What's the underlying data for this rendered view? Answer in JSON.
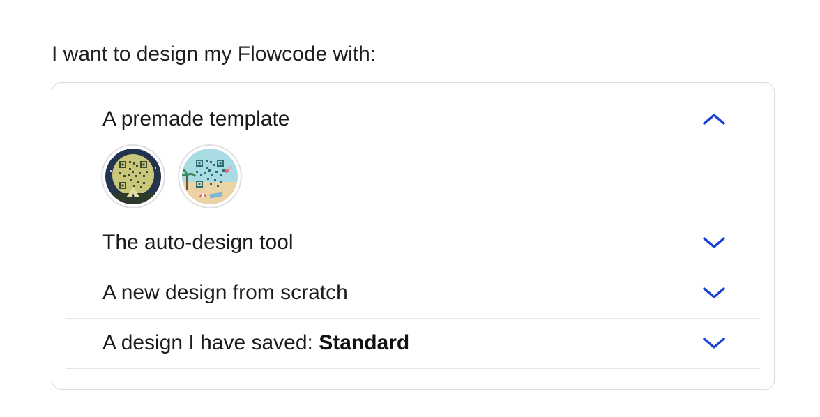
{
  "heading": "I want to design my Flowcode with:",
  "accent_color": "#1a3fd6",
  "sections": [
    {
      "label": "A premade template",
      "expanded": true,
      "chevron": "chevron-up-icon",
      "templates": [
        {
          "name": "camping-night-template",
          "icon": "qr-code-tent-night-thumbnail"
        },
        {
          "name": "beach-template",
          "icon": "qr-code-beach-thumbnail"
        }
      ]
    },
    {
      "label": "The auto-design tool",
      "expanded": false,
      "chevron": "chevron-down-icon"
    },
    {
      "label": "A new design from scratch",
      "expanded": false,
      "chevron": "chevron-down-icon"
    },
    {
      "label": "A design I have saved: ",
      "label_strong": "Standard",
      "expanded": false,
      "chevron": "chevron-down-icon"
    }
  ]
}
